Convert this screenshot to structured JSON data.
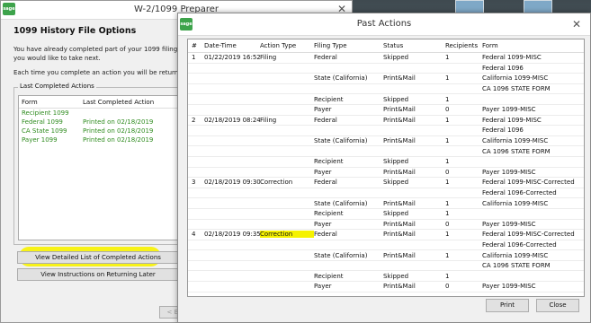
{
  "back_window": {
    "title": "W-2/1099 Preparer",
    "heading": "1099 History File Options",
    "para1_line1": "You have already completed part of your 1099 filings. Please i",
    "para1_line2": "you would like to take next.",
    "para2": "Each time you complete an action you will be returned to this s",
    "group_label": "Last Completed Actions",
    "list_headers": [
      "Form",
      "Last Completed Action"
    ],
    "list_rows": [
      {
        "form": "Recipient 1099",
        "action": ""
      },
      {
        "form": "Federal 1099",
        "action": "Printed on 02/18/2019"
      },
      {
        "form": "CA State 1099",
        "action": "Printed on 02/18/2019"
      },
      {
        "form": "Payer 1099",
        "action": "Printed on 02/18/2019"
      }
    ],
    "btn_detailed": "View Detailed List of Completed Actions",
    "btn_instructions": "View Instructions on Returning Later",
    "btn_back": "< B"
  },
  "dialog": {
    "title": "Past Actions",
    "headers": [
      "#",
      "Date-Time",
      "Action Type",
      "Filing Type",
      "Status",
      "Recipients",
      "Form"
    ],
    "rows": [
      [
        "1",
        "01/22/2019 16:52",
        "Filing",
        "Federal",
        "Skipped",
        "1",
        "Federal 1099-MISC"
      ],
      [
        "",
        "",
        "",
        "",
        "",
        "",
        "Federal 1096"
      ],
      [
        "",
        "",
        "",
        "State (California)",
        "Print&Mail",
        "1",
        "California 1099-MISC"
      ],
      [
        "",
        "",
        "",
        "",
        "",
        "",
        "CA 1096 STATE FORM"
      ],
      [
        "",
        "",
        "",
        "Recipient",
        "Skipped",
        "1",
        ""
      ],
      [
        "",
        "",
        "",
        "Payer",
        "Print&Mail",
        "0",
        "Payer 1099-MISC"
      ],
      [
        "2",
        "02/18/2019 08:24",
        "Filing",
        "Federal",
        "Print&Mail",
        "1",
        "Federal 1099-MISC"
      ],
      [
        "",
        "",
        "",
        "",
        "",
        "",
        "Federal 1096"
      ],
      [
        "",
        "",
        "",
        "State (California)",
        "Print&Mail",
        "1",
        "California 1099-MISC"
      ],
      [
        "",
        "",
        "",
        "",
        "",
        "",
        "CA 1096 STATE FORM"
      ],
      [
        "",
        "",
        "",
        "Recipient",
        "Skipped",
        "1",
        ""
      ],
      [
        "",
        "",
        "",
        "Payer",
        "Print&Mail",
        "0",
        "Payer 1099-MISC"
      ],
      [
        "3",
        "02/18/2019 09:30",
        "Correction",
        "Federal",
        "Skipped",
        "1",
        "Federal 1099-MISC-Corrected"
      ],
      [
        "",
        "",
        "",
        "",
        "",
        "",
        "Federal 1096-Corrected"
      ],
      [
        "",
        "",
        "",
        "State (California)",
        "Print&Mail",
        "1",
        "California 1099-MISC"
      ],
      [
        "",
        "",
        "",
        "Recipient",
        "Skipped",
        "1",
        ""
      ],
      [
        "",
        "",
        "",
        "Payer",
        "Print&Mail",
        "0",
        "Payer 1099-MISC"
      ],
      [
        "4",
        "02/18/2019 09:35",
        "Correction",
        "Federal",
        "Print&Mail",
        "1",
        "Federal 1099-MISC-Corrected"
      ],
      [
        "",
        "",
        "",
        "",
        "",
        "",
        "Federal 1096-Corrected"
      ],
      [
        "",
        "",
        "",
        "State (California)",
        "Print&Mail",
        "1",
        "California 1099-MISC"
      ],
      [
        "",
        "",
        "",
        "",
        "",
        "",
        "CA 1096 STATE FORM"
      ],
      [
        "",
        "",
        "",
        "Recipient",
        "Skipped",
        "1",
        ""
      ],
      [
        "",
        "",
        "",
        "Payer",
        "Print&Mail",
        "0",
        "Payer 1099-MISC"
      ]
    ],
    "btn_print": "Print",
    "btn_close": "Close"
  },
  "logo": "sage"
}
